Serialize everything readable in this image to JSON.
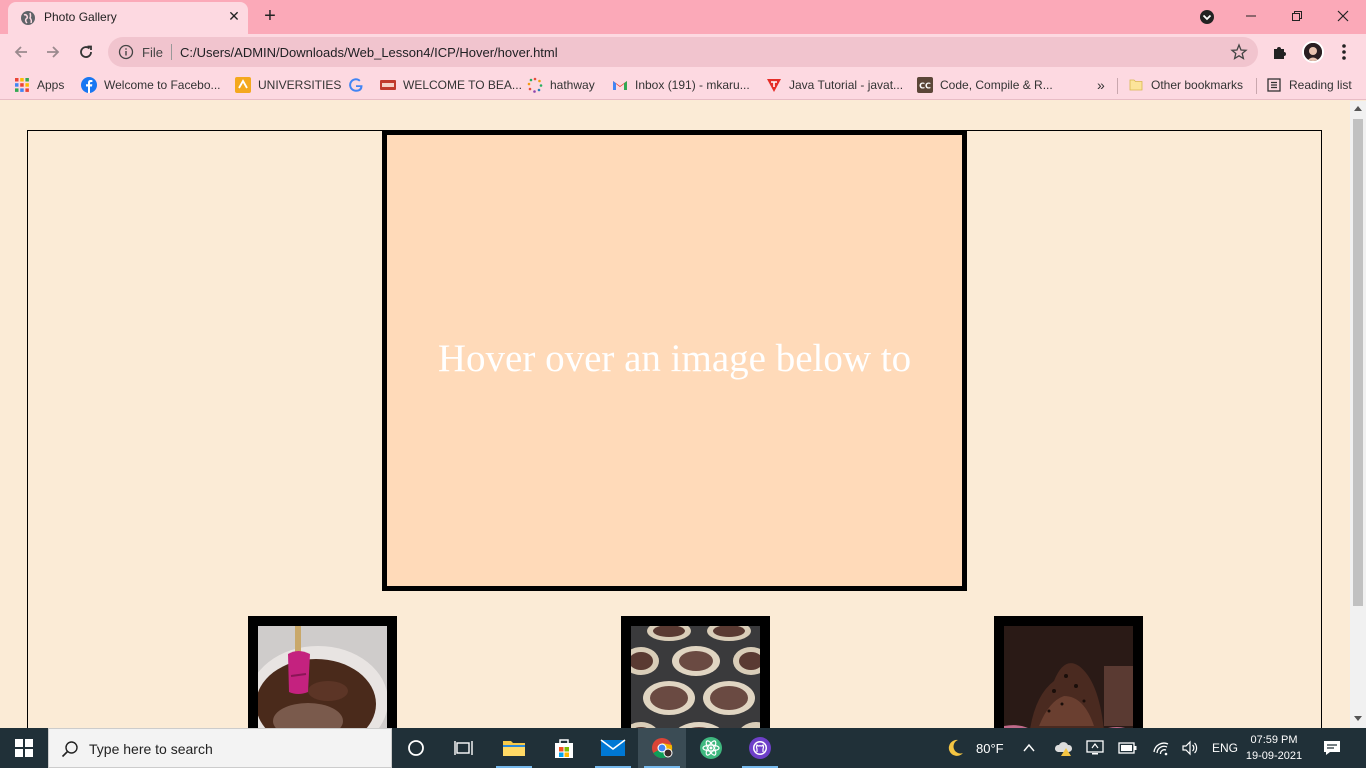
{
  "browser": {
    "tab": {
      "title": "Photo Gallery"
    },
    "omnibox": {
      "scheme": "File",
      "url": "C:/Users/ADMIN/Downloads/Web_Lesson4/ICP/Hover/hover.html"
    },
    "bookmarks": [
      {
        "label": "Apps",
        "icon": "apps-grid-icon"
      },
      {
        "label": "Welcome to Facebo...",
        "icon": "facebook-icon"
      },
      {
        "label": "UNIVERSITIES",
        "icon": "bookmark-site-icon"
      },
      {
        "label": "",
        "icon": "google-icon"
      },
      {
        "label": "WELCOME TO BEA...",
        "icon": "bookmark-site-icon"
      },
      {
        "label": "hathway",
        "icon": "hathway-icon"
      },
      {
        "label": "Inbox (191) - mkaru...",
        "icon": "gmail-icon"
      },
      {
        "label": "Java Tutorial - javat...",
        "icon": "javatpoint-icon"
      },
      {
        "label": "Code, Compile & R...",
        "icon": "codechef-icon"
      }
    ],
    "more_bookmarks": "»",
    "other_bookmarks": "Other bookmarks",
    "reading_list": "Reading list"
  },
  "page": {
    "preview_text": "Hover over an image below to",
    "thumbnails": [
      {
        "name": "thumbnail-batter"
      },
      {
        "name": "thumbnail-cupcake-tray"
      },
      {
        "name": "thumbnail-chocolate-cupcake"
      }
    ]
  },
  "taskbar": {
    "search_placeholder": "Type here to search",
    "weather": "80°F",
    "language": "ENG",
    "time": "07:59 PM",
    "date": "19-09-2021"
  },
  "colors": {
    "tabstrip": "#fba9b8",
    "toolbar": "#fdd9e1",
    "page_bg": "#fbebd6",
    "preview_bg": "#ffdab9",
    "taskbar": "#203038"
  }
}
